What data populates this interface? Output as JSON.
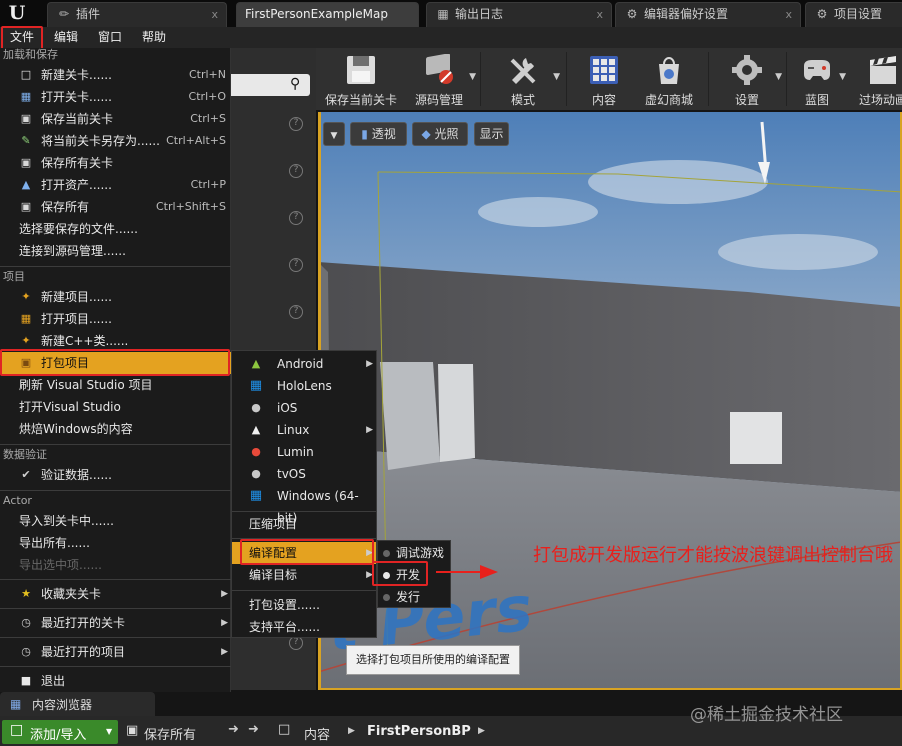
{
  "tabs": [
    {
      "label": "插件",
      "icon": "plug-icon"
    },
    {
      "label": "FirstPersonExampleMap",
      "icon": "map-icon"
    },
    {
      "label": "输出日志",
      "icon": "log-icon"
    },
    {
      "label": "编辑器偏好设置",
      "icon": "preferences-icon"
    },
    {
      "label": "项目设置",
      "icon": "project-settings-icon"
    }
  ],
  "tab_close": "x",
  "logo": "U",
  "menubar": {
    "file": "文件",
    "edit": "编辑",
    "window": "窗口",
    "help": "帮助"
  },
  "file_menu": {
    "sections": {
      "load_save": "加载和保存",
      "project": "项目",
      "data_validation": "数据验证",
      "actor": "Actor"
    },
    "items": [
      {
        "label": "新建关卡......",
        "shortcut": "Ctrl+N",
        "icon": "new-level-icon"
      },
      {
        "label": "打开关卡......",
        "shortcut": "Ctrl+O",
        "icon": "open-level-icon"
      },
      {
        "label": "保存当前关卡",
        "shortcut": "Ctrl+S",
        "icon": "save-icon"
      },
      {
        "label": "将当前关卡另存为......",
        "shortcut": "Ctrl+Alt+S",
        "icon": "save-as-icon"
      },
      {
        "label": "保存所有关卡",
        "shortcut": "",
        "icon": "save-all-levels-icon"
      },
      {
        "label": "打开资产......",
        "shortcut": "Ctrl+P",
        "icon": "open-asset-icon"
      },
      {
        "label": "保存所有",
        "shortcut": "Ctrl+Shift+S",
        "icon": "save-all-icon"
      },
      {
        "label": "选择要保存的文件......",
        "shortcut": "",
        "icon": ""
      },
      {
        "label": "连接到源码管理......",
        "shortcut": "",
        "icon": ""
      },
      {
        "label": "新建项目......",
        "icon": "new-project-icon"
      },
      {
        "label": "打开项目......",
        "icon": "open-project-icon"
      },
      {
        "label": "新建C++类......",
        "icon": "new-cpp-class-icon"
      },
      {
        "label": "打包项目",
        "icon": "package-icon"
      },
      {
        "label": "刷新 Visual Studio 项目",
        "icon": ""
      },
      {
        "label": "打开Visual Studio",
        "icon": ""
      },
      {
        "label": "烘焙Windows的内容",
        "icon": ""
      },
      {
        "label": "验证数据......",
        "icon": "validate-icon"
      },
      {
        "label": "导入到关卡中......",
        "icon": ""
      },
      {
        "label": "导出所有......",
        "icon": ""
      },
      {
        "label": "导出选中项......",
        "icon": ""
      },
      {
        "label": "收藏夹关卡",
        "icon": "star-icon"
      },
      {
        "label": "最近打开的关卡",
        "icon": "recent-levels-icon"
      },
      {
        "label": "最近打开的项目",
        "icon": "recent-projects-icon"
      },
      {
        "label": "退出",
        "icon": "exit-icon"
      }
    ]
  },
  "platform_menu": {
    "items": [
      {
        "label": "Android",
        "icon": "android-icon"
      },
      {
        "label": "HoloLens",
        "icon": "windows-icon"
      },
      {
        "label": "iOS",
        "icon": "apple-icon"
      },
      {
        "label": "Linux",
        "icon": "linux-icon"
      },
      {
        "label": "Lumin",
        "icon": "lumin-icon"
      },
      {
        "label": "tvOS",
        "icon": "apple-icon"
      },
      {
        "label": "Windows (64-bit)",
        "icon": "windows-icon"
      }
    ],
    "zip": "压缩项目",
    "build_config": "编译配置",
    "build_target": "编译目标",
    "packaging_settings": "打包设置......",
    "supported_platforms": "支持平台......"
  },
  "config_menu": {
    "items": [
      "调试游戏",
      "开发",
      "发行"
    ],
    "selected": "开发"
  },
  "tooltip": "选择打包项目所使用的编译配置",
  "annotation": "打包成开发版运行才能按波浪键调出控制台哦",
  "toolbar": {
    "items": [
      {
        "label": "保存当前关卡",
        "icon": "save-icon"
      },
      {
        "label": "源码管理",
        "icon": "source-control-icon"
      },
      {
        "label": "模式",
        "icon": "modes-icon"
      },
      {
        "label": "内容",
        "icon": "content-icon"
      },
      {
        "label": "虚幻商城",
        "icon": "marketplace-icon"
      },
      {
        "label": "设置",
        "icon": "settings-icon"
      },
      {
        "label": "蓝图",
        "icon": "blueprint-icon"
      },
      {
        "label": "过场动画",
        "icon": "cinematics-icon"
      }
    ]
  },
  "viewport": {
    "perspective": "透视",
    "lit": "光照",
    "show": "显示",
    "floor_text": "t Pers"
  },
  "content_browser": {
    "tab": "内容浏览器",
    "add_import": "添加/导入",
    "save_all": "保存所有",
    "path": [
      "内容",
      "FirstPersonBP"
    ]
  },
  "watermark": "@稀土掘金技术社区",
  "colors": {
    "highlight": "#e4a220",
    "annotation": "#e8201c",
    "add_button": "#3a8a2a"
  }
}
